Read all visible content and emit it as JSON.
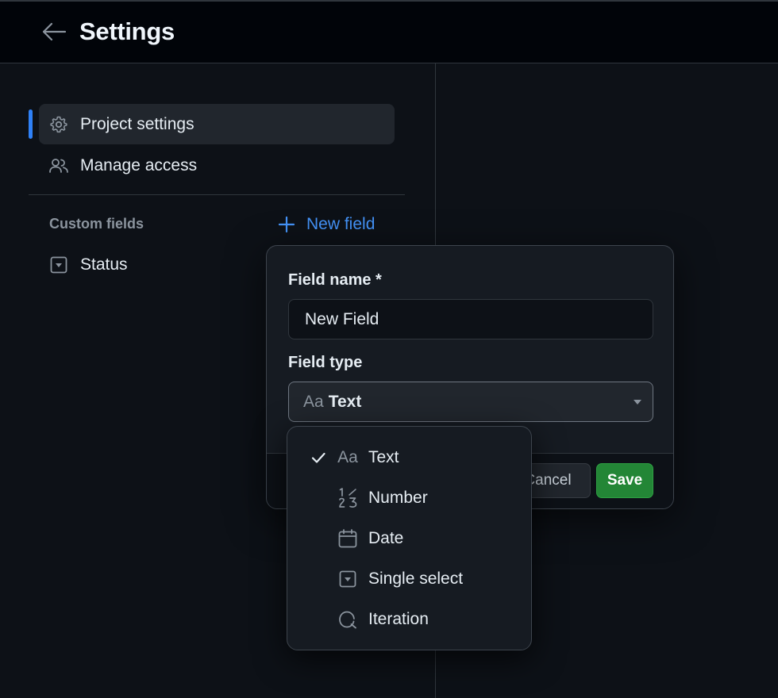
{
  "header": {
    "title": "Settings"
  },
  "sidebar": {
    "items": [
      {
        "label": "Project settings",
        "icon": "gear-icon"
      },
      {
        "label": "Manage access",
        "icon": "people-icon"
      }
    ],
    "custom_fields_label": "Custom fields",
    "new_field_label": "New field",
    "fields": [
      {
        "label": "Status",
        "icon": "single-select-icon"
      }
    ]
  },
  "dialog": {
    "field_name_label": "Field name *",
    "field_name_value": "New Field",
    "field_type_label": "Field type",
    "field_type_glyph": "Aa",
    "field_type_value": "Text",
    "cancel_label": "Cancel",
    "save_label": "Save"
  },
  "dropdown": {
    "options": [
      {
        "label": "Text",
        "icon": "text-icon",
        "glyph": "Aa",
        "selected": true
      },
      {
        "label": "Number",
        "icon": "number-icon",
        "selected": false
      },
      {
        "label": "Date",
        "icon": "calendar-icon",
        "selected": false
      },
      {
        "label": "Single select",
        "icon": "single-select-icon",
        "selected": false
      },
      {
        "label": "Iteration",
        "icon": "iteration-icon",
        "selected": false
      }
    ]
  },
  "colors": {
    "background": "#0d1117",
    "header": "#010409",
    "accent": "#2f81f7",
    "link": "#4493f8",
    "save": "#238636"
  }
}
